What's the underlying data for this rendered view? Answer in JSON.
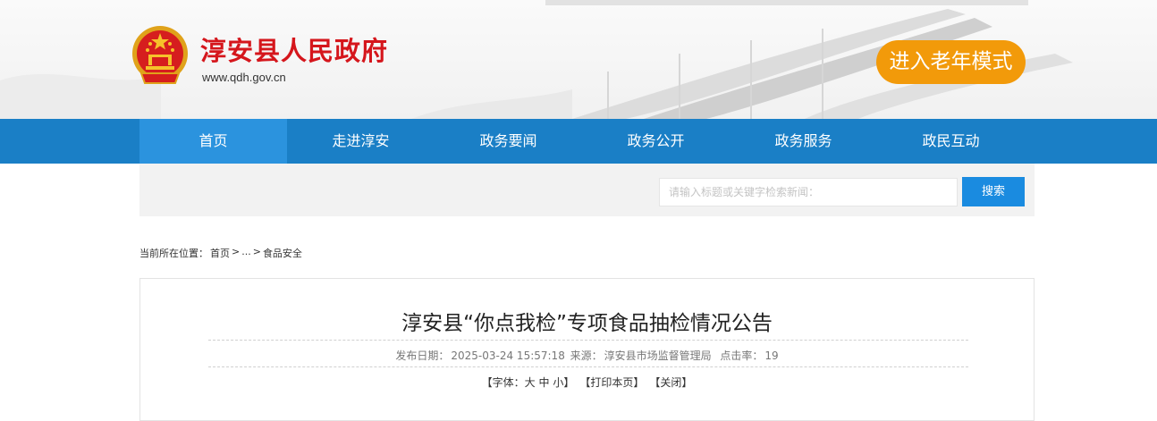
{
  "header": {
    "site_title": "淳安县人民政府",
    "site_url": "www.qdh.gov.cn",
    "elder_mode_label": "进入老年模式",
    "emblem_icon": "national-emblem-icon",
    "colors": {
      "title_red": "#d5161c",
      "elder_orange": "#f29a0a"
    }
  },
  "nav": {
    "items": [
      {
        "label": "首页",
        "active": true
      },
      {
        "label": "走进淳安"
      },
      {
        "label": "政务要闻"
      },
      {
        "label": "政务公开"
      },
      {
        "label": "政务服务"
      },
      {
        "label": "政民互动"
      }
    ],
    "colors": {
      "bar": "#1a7fc6",
      "active": "#2b93de"
    }
  },
  "search": {
    "placeholder": "请输入标题或关键字检索新闻：",
    "button_label": "搜索"
  },
  "breadcrumb": {
    "prefix": "当前所在位置：",
    "home": "首页",
    "sep": ">",
    "ellipsis": "...",
    "current": "食品安全"
  },
  "article": {
    "title": "淳安县“你点我检”专项食品抽检情况公告",
    "meta": {
      "date_label": "发布日期：",
      "date": "2025-03-24 15:57:18",
      "source_label": "来源：",
      "source": "淳安县市场监督管理局",
      "hits_label": "点击率：",
      "hits": "19"
    },
    "tools": {
      "font_label": "【字体：",
      "font_large": "大",
      "font_medium": "中",
      "font_small": "小",
      "font_close": "】",
      "print_label": "【打印本页】",
      "close_label": "【关闭】"
    }
  }
}
